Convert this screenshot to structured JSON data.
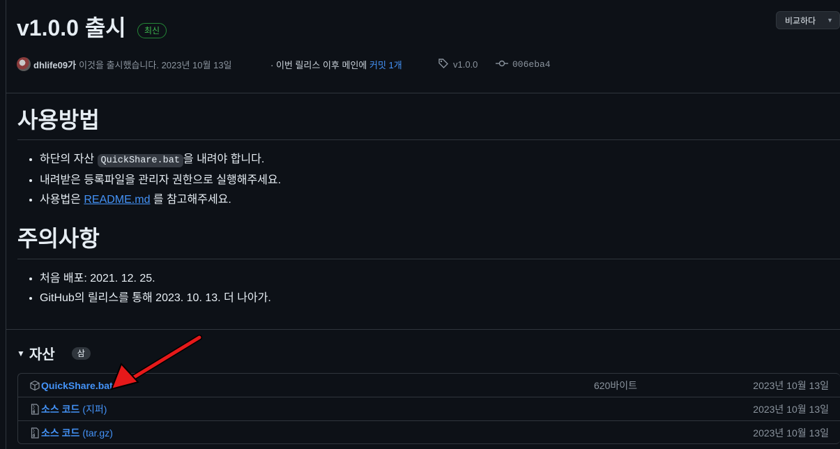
{
  "release": {
    "title": "v1.0.0 출시",
    "latest_badge": "최신",
    "compare_label": "비교하다"
  },
  "meta": {
    "author": "dhlife09가",
    "released_text": "이것을 출시했습니다. 2023년 10월 13일",
    "since_text": "· 이번 릴리스 이후 메인에",
    "commits_link": "커밋 1개",
    "tag": "v1.0.0",
    "commit": "006eba4"
  },
  "body": {
    "section1_title": "사용방법",
    "s1_item1_pre": "하단의 자산",
    "s1_item1_code": "QuickShare.bat",
    "s1_item1_post": "을 내려야 합니다.",
    "s1_item2": "내려받은 등록파일을 관리자 권한으로 실행해주세요.",
    "s1_item3_pre": "사용법은",
    "s1_item3_link": "README.md",
    "s1_item3_post": "를 참고해주세요.",
    "section2_title": "주의사항",
    "s2_item1": "처음 배포: 2021. 12. 25.",
    "s2_item2": "GitHub의 릴리스를 통해 2023. 10. 13. 더 나아가."
  },
  "assets": {
    "label": "자산",
    "count": "삼",
    "rows": [
      {
        "name": "QuickShare.bat",
        "size": "620바이트",
        "date": "2023년 10월 13일"
      },
      {
        "name": "소스 코드",
        "suffix": "(지퍼)",
        "size": "",
        "date": "2023년 10월 13일"
      },
      {
        "name": "소스 코드",
        "suffix": "(tar.gz)",
        "size": "",
        "date": "2023년 10월 13일"
      }
    ]
  },
  "colors": {
    "background": "#0d1117",
    "link": "#4493f8",
    "badge_green": "#3fb950",
    "annotation_arrow": "#e5191a"
  },
  "icons": [
    "tag-icon",
    "commit-icon",
    "package-icon",
    "file-zip-icon",
    "caret-down-icon",
    "triangle-down-icon"
  ]
}
